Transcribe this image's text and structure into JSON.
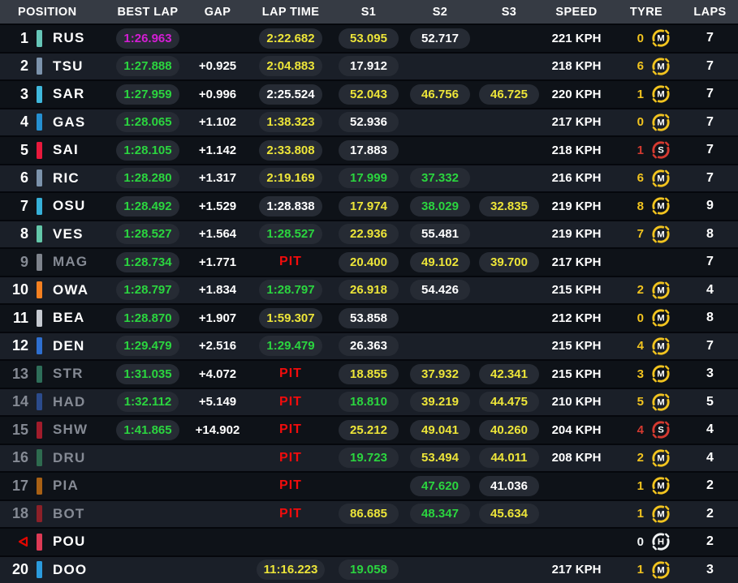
{
  "header": {
    "position": "POSITION",
    "best_lap": "BEST LAP",
    "gap": "GAP",
    "lap_time": "LAP TIME",
    "s1": "S1",
    "s2": "S2",
    "s3": "S3",
    "speed": "SPEED",
    "tyre": "TYRE",
    "laps": "LAPS"
  },
  "palette": {
    "yellow": "#EDE539",
    "green": "#2BD53F",
    "purple": "#D41DD4",
    "white": "#FFFFFF",
    "red": "#F20C0C",
    "muted_text": "#858A94",
    "tyre_medium": "#F2C41F",
    "tyre_soft": "#D53A30",
    "tyre_hard": "#F0F3F4",
    "retired_red": "#E10600"
  },
  "rows": [
    {
      "position": "1",
      "retired": false,
      "muted": false,
      "team_color": "#66C6B8",
      "driver": "RUS",
      "best_lap": {
        "value": "1:26.963",
        "color": "purple"
      },
      "gap": "",
      "lap_time": {
        "value": "2:22.682",
        "color": "yellow",
        "pit": false
      },
      "s1": {
        "value": "53.095",
        "color": "yellow"
      },
      "s2": {
        "value": "52.717",
        "color": "white"
      },
      "s3": null,
      "speed": "221 KPH",
      "tyre": {
        "count": "0",
        "compound": "M"
      },
      "laps": "7"
    },
    {
      "position": "2",
      "retired": false,
      "muted": false,
      "team_color": "#7C93AC",
      "driver": "TSU",
      "best_lap": {
        "value": "1:27.888",
        "color": "green"
      },
      "gap": "+0.925",
      "lap_time": {
        "value": "2:04.883",
        "color": "yellow",
        "pit": false
      },
      "s1": {
        "value": "17.912",
        "color": "white"
      },
      "s2": null,
      "s3": null,
      "speed": "218 KPH",
      "tyre": {
        "count": "6",
        "compound": "M"
      },
      "laps": "7"
    },
    {
      "position": "3",
      "retired": false,
      "muted": false,
      "team_color": "#3FB8DC",
      "driver": "SAR",
      "best_lap": {
        "value": "1:27.959",
        "color": "green"
      },
      "gap": "+0.996",
      "lap_time": {
        "value": "2:25.524",
        "color": "white",
        "pit": false
      },
      "s1": {
        "value": "52.043",
        "color": "yellow"
      },
      "s2": {
        "value": "46.756",
        "color": "yellow"
      },
      "s3": {
        "value": "46.725",
        "color": "yellow"
      },
      "speed": "220 KPH",
      "tyre": {
        "count": "1",
        "compound": "M"
      },
      "laps": "7"
    },
    {
      "position": "4",
      "retired": false,
      "muted": false,
      "team_color": "#2590D2",
      "driver": "GAS",
      "best_lap": {
        "value": "1:28.065",
        "color": "green"
      },
      "gap": "+1.102",
      "lap_time": {
        "value": "1:38.323",
        "color": "yellow",
        "pit": false
      },
      "s1": {
        "value": "52.936",
        "color": "white"
      },
      "s2": null,
      "s3": null,
      "speed": "217 KPH",
      "tyre": {
        "count": "0",
        "compound": "M"
      },
      "laps": "7"
    },
    {
      "position": "5",
      "retired": false,
      "muted": false,
      "team_color": "#E8193C",
      "driver": "SAI",
      "best_lap": {
        "value": "1:28.105",
        "color": "green"
      },
      "gap": "+1.142",
      "lap_time": {
        "value": "2:33.808",
        "color": "yellow",
        "pit": false
      },
      "s1": {
        "value": "17.883",
        "color": "white"
      },
      "s2": null,
      "s3": null,
      "speed": "218 KPH",
      "tyre": {
        "count": "1",
        "compound": "S"
      },
      "laps": "7"
    },
    {
      "position": "6",
      "retired": false,
      "muted": false,
      "team_color": "#7C93AC",
      "driver": "RIC",
      "best_lap": {
        "value": "1:28.280",
        "color": "green"
      },
      "gap": "+1.317",
      "lap_time": {
        "value": "2:19.169",
        "color": "yellow",
        "pit": false
      },
      "s1": {
        "value": "17.999",
        "color": "green"
      },
      "s2": {
        "value": "37.332",
        "color": "green"
      },
      "s3": null,
      "speed": "216 KPH",
      "tyre": {
        "count": "6",
        "compound": "M"
      },
      "laps": "7"
    },
    {
      "position": "7",
      "retired": false,
      "muted": false,
      "team_color": "#36B0D8",
      "driver": "OSU",
      "best_lap": {
        "value": "1:28.492",
        "color": "green"
      },
      "gap": "+1.529",
      "lap_time": {
        "value": "1:28.838",
        "color": "white",
        "pit": false
      },
      "s1": {
        "value": "17.974",
        "color": "yellow"
      },
      "s2": {
        "value": "38.029",
        "color": "green"
      },
      "s3": {
        "value": "32.835",
        "color": "yellow"
      },
      "speed": "219 KPH",
      "tyre": {
        "count": "8",
        "compound": "M"
      },
      "laps": "9"
    },
    {
      "position": "8",
      "retired": false,
      "muted": false,
      "team_color": "#63C7A9",
      "driver": "VES",
      "best_lap": {
        "value": "1:28.527",
        "color": "green"
      },
      "gap": "+1.564",
      "lap_time": {
        "value": "1:28.527",
        "color": "green",
        "pit": false
      },
      "s1": {
        "value": "22.936",
        "color": "yellow"
      },
      "s2": {
        "value": "55.481",
        "color": "white"
      },
      "s3": null,
      "speed": "219 KPH",
      "tyre": {
        "count": "7",
        "compound": "M"
      },
      "laps": "8"
    },
    {
      "position": "9",
      "retired": false,
      "muted": true,
      "team_color": "#7E838C",
      "driver": "MAG",
      "best_lap": {
        "value": "1:28.734",
        "color": "green"
      },
      "gap": "+1.771",
      "lap_time": {
        "value": "PIT",
        "color": "red",
        "pit": true
      },
      "s1": {
        "value": "20.400",
        "color": "yellow"
      },
      "s2": {
        "value": "49.102",
        "color": "yellow"
      },
      "s3": {
        "value": "39.700",
        "color": "yellow"
      },
      "speed": "217 KPH",
      "tyre": null,
      "laps": "7"
    },
    {
      "position": "10",
      "retired": false,
      "muted": false,
      "team_color": "#F58020",
      "driver": "OWA",
      "best_lap": {
        "value": "1:28.797",
        "color": "green"
      },
      "gap": "+1.834",
      "lap_time": {
        "value": "1:28.797",
        "color": "green",
        "pit": false
      },
      "s1": {
        "value": "26.918",
        "color": "yellow"
      },
      "s2": {
        "value": "54.426",
        "color": "white"
      },
      "s3": null,
      "speed": "215 KPH",
      "tyre": {
        "count": "2",
        "compound": "M"
      },
      "laps": "4"
    },
    {
      "position": "11",
      "retired": false,
      "muted": false,
      "team_color": "#C6CAD1",
      "driver": "BEA",
      "best_lap": {
        "value": "1:28.870",
        "color": "green"
      },
      "gap": "+1.907",
      "lap_time": {
        "value": "1:59.307",
        "color": "yellow",
        "pit": false
      },
      "s1": {
        "value": "53.858",
        "color": "white"
      },
      "s2": null,
      "s3": null,
      "speed": "212 KPH",
      "tyre": {
        "count": "0",
        "compound": "M"
      },
      "laps": "8"
    },
    {
      "position": "12",
      "retired": false,
      "muted": false,
      "team_color": "#2E6FD0",
      "driver": "DEN",
      "best_lap": {
        "value": "1:29.479",
        "color": "green"
      },
      "gap": "+2.516",
      "lap_time": {
        "value": "1:29.479",
        "color": "green",
        "pit": false
      },
      "s1": {
        "value": "26.363",
        "color": "white"
      },
      "s2": null,
      "s3": null,
      "speed": "215 KPH",
      "tyre": {
        "count": "4",
        "compound": "M"
      },
      "laps": "7"
    },
    {
      "position": "13",
      "retired": false,
      "muted": true,
      "team_color": "#2E6E59",
      "driver": "STR",
      "best_lap": {
        "value": "1:31.035",
        "color": "green"
      },
      "gap": "+4.072",
      "lap_time": {
        "value": "PIT",
        "color": "red",
        "pit": true
      },
      "s1": {
        "value": "18.855",
        "color": "yellow"
      },
      "s2": {
        "value": "37.932",
        "color": "yellow"
      },
      "s3": {
        "value": "42.341",
        "color": "yellow"
      },
      "speed": "215 KPH",
      "tyre": {
        "count": "3",
        "compound": "M"
      },
      "laps": "3"
    },
    {
      "position": "14",
      "retired": false,
      "muted": true,
      "team_color": "#2B4B8C",
      "driver": "HAD",
      "best_lap": {
        "value": "1:32.112",
        "color": "green"
      },
      "gap": "+5.149",
      "lap_time": {
        "value": "PIT",
        "color": "red",
        "pit": true
      },
      "s1": {
        "value": "18.810",
        "color": "green"
      },
      "s2": {
        "value": "39.219",
        "color": "yellow"
      },
      "s3": {
        "value": "44.475",
        "color": "yellow"
      },
      "speed": "210 KPH",
      "tyre": {
        "count": "5",
        "compound": "M"
      },
      "laps": "5"
    },
    {
      "position": "15",
      "retired": false,
      "muted": true,
      "team_color": "#A11C2B",
      "driver": "SHW",
      "best_lap": {
        "value": "1:41.865",
        "color": "green"
      },
      "gap": "+14.902",
      "lap_time": {
        "value": "PIT",
        "color": "red",
        "pit": true
      },
      "s1": {
        "value": "25.212",
        "color": "yellow"
      },
      "s2": {
        "value": "49.041",
        "color": "yellow"
      },
      "s3": {
        "value": "40.260",
        "color": "yellow"
      },
      "speed": "204 KPH",
      "tyre": {
        "count": "4",
        "compound": "S"
      },
      "laps": "4"
    },
    {
      "position": "16",
      "retired": false,
      "muted": true,
      "team_color": "#2E6B4F",
      "driver": "DRU",
      "best_lap": null,
      "gap": "",
      "lap_time": {
        "value": "PIT",
        "color": "red",
        "pit": true
      },
      "s1": {
        "value": "19.723",
        "color": "green"
      },
      "s2": {
        "value": "53.494",
        "color": "yellow"
      },
      "s3": {
        "value": "44.011",
        "color": "yellow"
      },
      "speed": "208 KPH",
      "tyre": {
        "count": "2",
        "compound": "M"
      },
      "laps": "4"
    },
    {
      "position": "17",
      "retired": false,
      "muted": true,
      "team_color": "#A86014",
      "driver": "PIA",
      "best_lap": null,
      "gap": "",
      "lap_time": {
        "value": "PIT",
        "color": "red",
        "pit": true
      },
      "s1": null,
      "s2": {
        "value": "47.620",
        "color": "green"
      },
      "s3": {
        "value": "41.036",
        "color": "white"
      },
      "speed": "",
      "tyre": {
        "count": "1",
        "compound": "M"
      },
      "laps": "2"
    },
    {
      "position": "18",
      "retired": false,
      "muted": true,
      "team_color": "#8C2028",
      "driver": "BOT",
      "best_lap": null,
      "gap": "",
      "lap_time": {
        "value": "PIT",
        "color": "red",
        "pit": true
      },
      "s1": {
        "value": "86.685",
        "color": "yellow"
      },
      "s2": {
        "value": "48.347",
        "color": "green"
      },
      "s3": {
        "value": "45.634",
        "color": "yellow"
      },
      "speed": "",
      "tyre": {
        "count": "1",
        "compound": "M"
      },
      "laps": "2"
    },
    {
      "position": null,
      "retired": true,
      "muted": false,
      "team_color": "#DD3A55",
      "driver": "POU",
      "best_lap": null,
      "gap": "",
      "lap_time": null,
      "s1": null,
      "s2": null,
      "s3": null,
      "speed": "",
      "tyre": {
        "count": "0",
        "compound": "H"
      },
      "laps": "2"
    },
    {
      "position": "20",
      "retired": false,
      "muted": false,
      "team_color": "#2B9BDD",
      "driver": "DOO",
      "best_lap": null,
      "gap": "",
      "lap_time": {
        "value": "11:16.223",
        "color": "yellow",
        "pit": false
      },
      "s1": {
        "value": "19.058",
        "color": "green"
      },
      "s2": null,
      "s3": null,
      "speed": "217 KPH",
      "tyre": {
        "count": "1",
        "compound": "M"
      },
      "laps": "3"
    }
  ]
}
